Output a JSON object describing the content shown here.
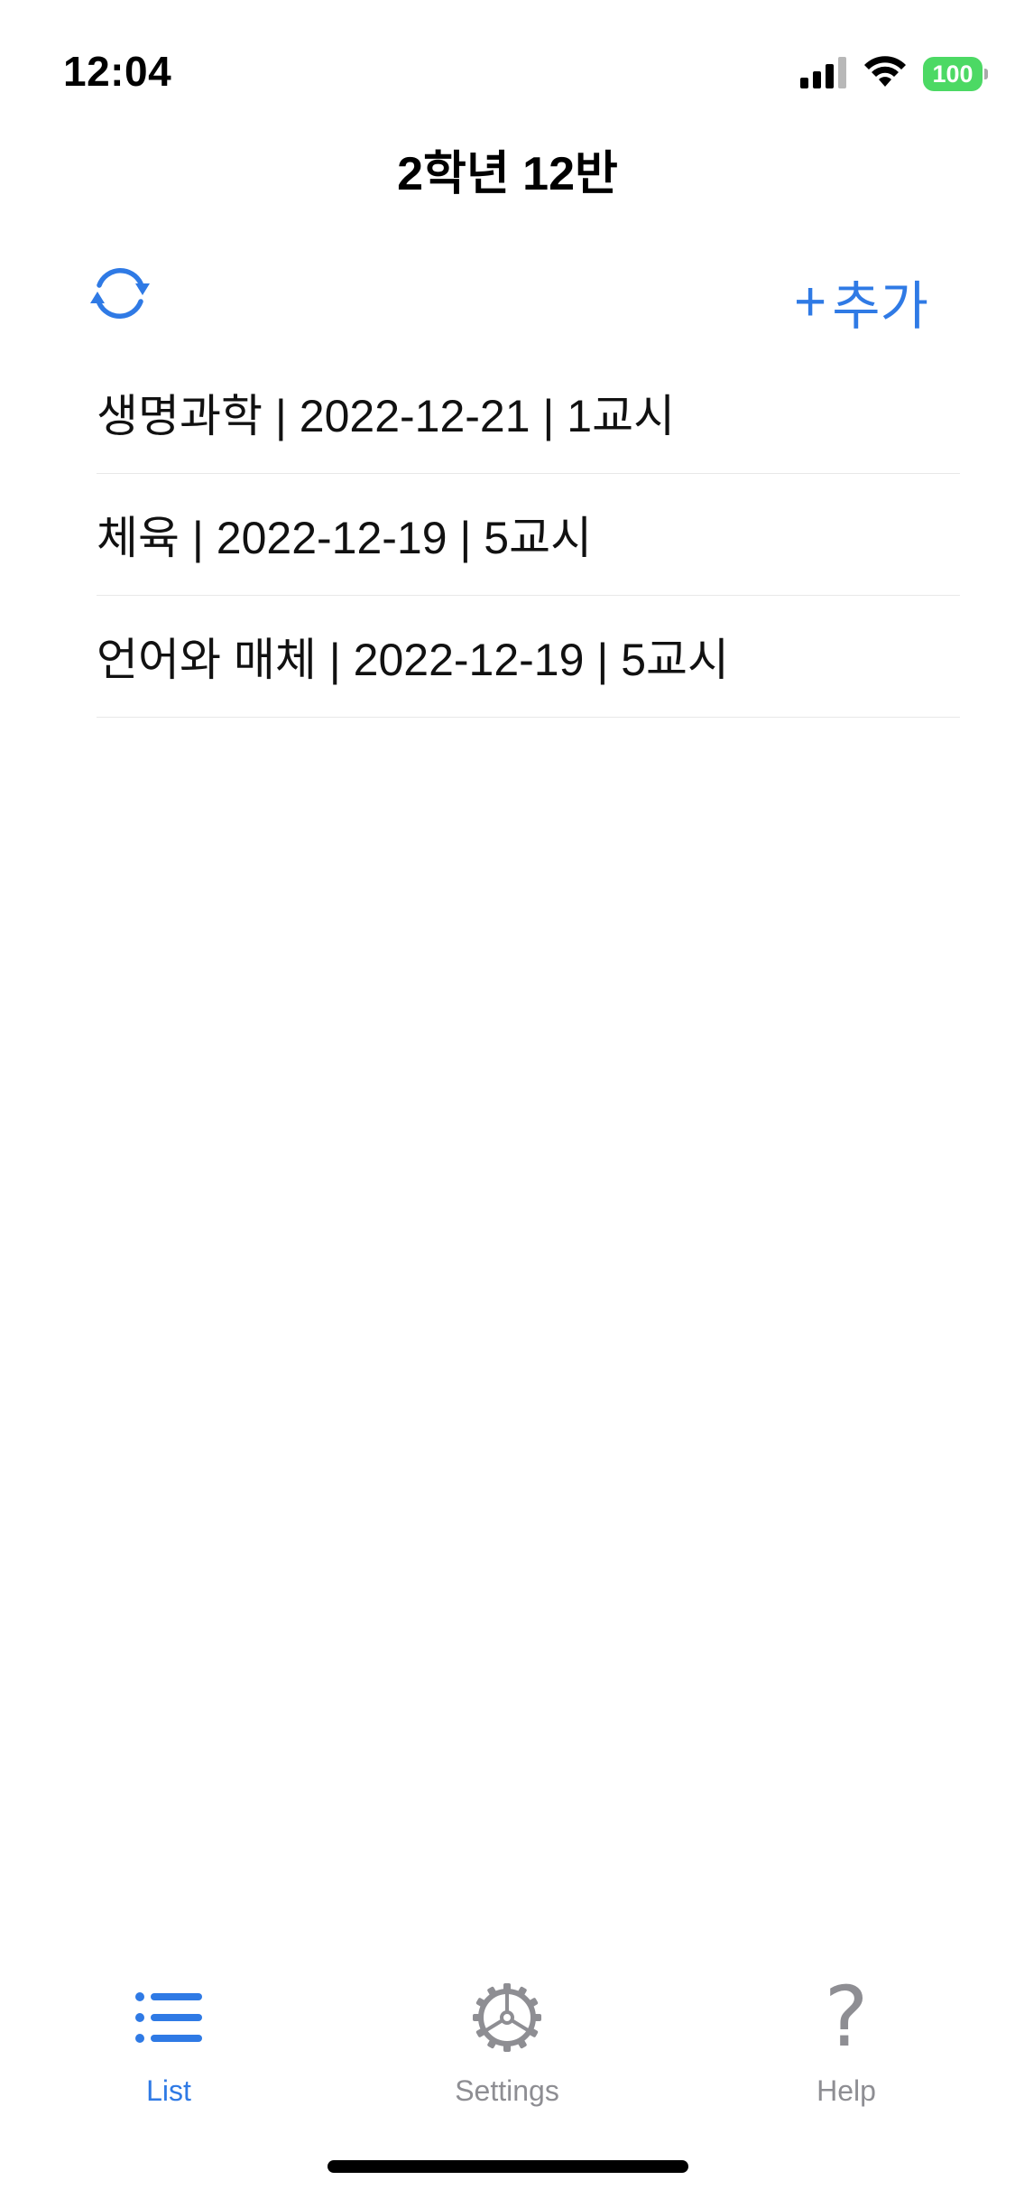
{
  "status_bar": {
    "time": "12:04",
    "battery": "100"
  },
  "nav": {
    "title": "2학년 12반"
  },
  "toolbar": {
    "add_plus": "+",
    "add_label": "추가"
  },
  "list": {
    "items": [
      "생명과학 | 2022-12-21 | 1교시",
      "체육 | 2022-12-19 | 5교시",
      "언어와 매체 | 2022-12-19 | 5교시"
    ]
  },
  "tabs": [
    {
      "label": "List",
      "icon": "list-icon",
      "active": true
    },
    {
      "label": "Settings",
      "icon": "gear-icon",
      "active": false
    },
    {
      "label": "Help",
      "icon": "question-mark-icon",
      "active": false
    }
  ],
  "colors": {
    "accent": "#2f7ae5",
    "inactive": "#8e8e93",
    "battery": "#4cd964"
  }
}
